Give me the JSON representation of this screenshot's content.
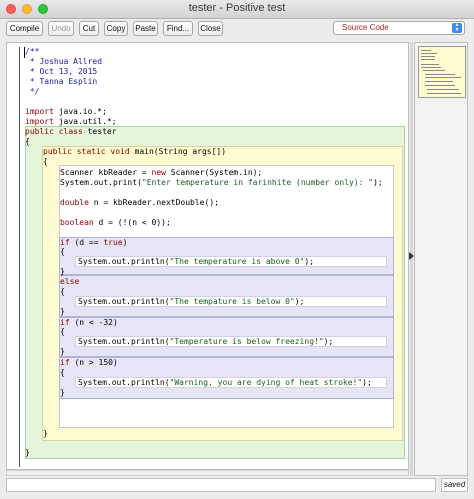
{
  "window": {
    "title": "tester - Positive test"
  },
  "toolbar": {
    "compile": "Compile",
    "undo": "Undo",
    "cut": "Cut",
    "copy": "Copy",
    "paste": "Paste",
    "find": "Find...",
    "close": "Close",
    "view_select": "Source Code"
  },
  "status": {
    "message": "",
    "saved": "saved"
  },
  "code": {
    "l1": "/**",
    "l2": " * Joshua Allred",
    "l3": " * Oct 13, 2015",
    "l4": " * Tanna Esplin",
    "l5": " */",
    "imp1_kw": "import",
    "imp1_rest": " java.io.*;",
    "imp2_kw": "import",
    "imp2_rest": " java.util.*;",
    "class_kw": "public class",
    "class_rest": " tester",
    "open1": "{",
    "m_kw": "public static void",
    "m_rest": " main(String args[])",
    "open2": "{",
    "s1": "Scanner kbReader = ",
    "s1_kw": "new",
    "s1_rest": " Scanner(System.in);",
    "s2_a": "System.out.print(",
    "s2_str": "\"Enter temperature in farinhite (number only): \"",
    "s2_b": ");",
    "s3_kw": "double",
    "s3_rest": " n = kbReader.nextDouble();",
    "s4_kw": "boolean",
    "s4_rest": " d = (!(n < 0));",
    "if1_kw": "if",
    "if1_a": " (d == ",
    "if1_true": "true",
    "if1_b": ")",
    "p1_a": "System.out.println(",
    "p1_str": "\"The temperature is above 0\"",
    "p1_b": ");",
    "else_kw": "else",
    "p2_a": "System.out.println(",
    "p2_str": "\"The tempature is below 0\"",
    "p2_b": ");",
    "if2_kw": "if",
    "if2_rest": " (n < -32)",
    "p3_a": "System.out.println(",
    "p3_str": "\"Temperature is below freezing!\"",
    "p3_b": ");",
    "if3_kw": "if",
    "if3_rest": " (n > 150)",
    "p4_a": "System.out.println(",
    "p4_str": "\"Warning, you are dying of heat stroke!\"",
    "p4_b": ");",
    "lb": "{",
    "rb": "}"
  }
}
